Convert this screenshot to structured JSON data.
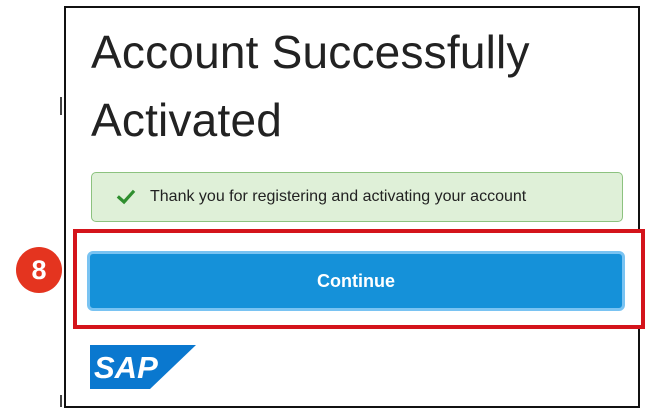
{
  "page": {
    "title": "Account Successfully Activated"
  },
  "success_message": {
    "text": "Thank you for registering and activating your account",
    "icon": "check-icon",
    "color": "#dff0d8"
  },
  "actions": {
    "continue_label": "Continue",
    "button_color": "#1591d9"
  },
  "callout": {
    "step_number": "8",
    "highlight_color": "#d4141b"
  },
  "branding": {
    "logo_text": "SAP",
    "logo_color": "#0a78cf"
  }
}
